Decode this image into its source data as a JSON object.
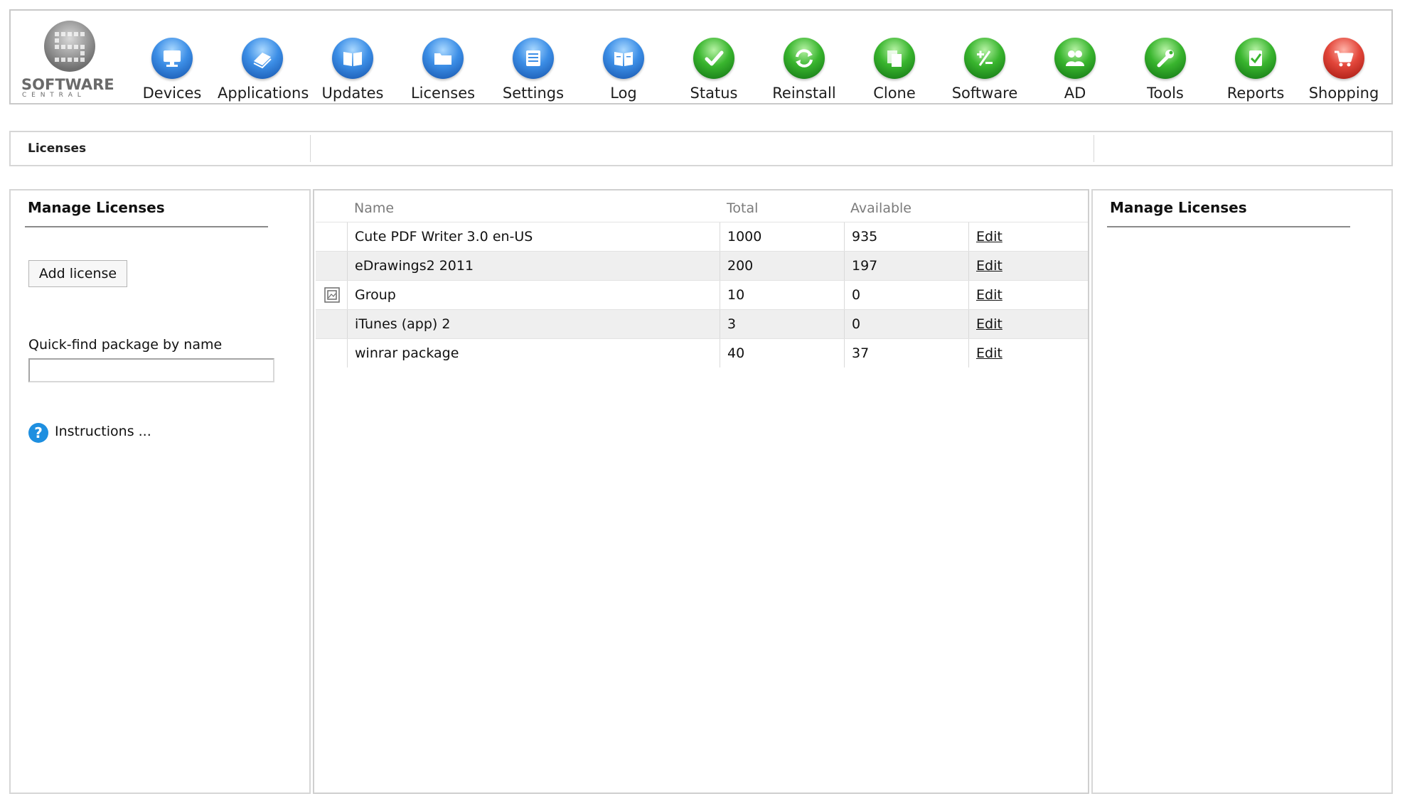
{
  "logo": {
    "text": "SOFTWARE",
    "subtext": "C E N T R A L"
  },
  "nav": [
    {
      "label": "Devices",
      "color": "blue",
      "icon": "monitor-icon"
    },
    {
      "label": "Applications",
      "color": "blue",
      "icon": "applications-icon"
    },
    {
      "label": "Updates",
      "color": "blue",
      "icon": "book-icon"
    },
    {
      "label": "Licenses",
      "color": "blue",
      "icon": "folder-icon"
    },
    {
      "label": "Settings",
      "color": "blue",
      "icon": "settings-icon"
    },
    {
      "label": "Log",
      "color": "blue",
      "icon": "log-book-icon"
    },
    {
      "label": "Status",
      "color": "green",
      "icon": "checkmark-icon"
    },
    {
      "label": "Reinstall",
      "color": "green",
      "icon": "refresh-icon"
    },
    {
      "label": "Clone",
      "color": "green",
      "icon": "copy-icon"
    },
    {
      "label": "Software",
      "color": "green",
      "icon": "plus-minus-icon"
    },
    {
      "label": "AD",
      "color": "green",
      "icon": "users-icon"
    },
    {
      "label": "Tools",
      "color": "green",
      "icon": "wrench-icon"
    },
    {
      "label": "Reports",
      "color": "green",
      "icon": "report-check-icon"
    },
    {
      "label": "Shopping",
      "color": "red",
      "icon": "shopping-cart-icon"
    }
  ],
  "breadcrumb": "Licenses",
  "left_panel": {
    "title": "Manage Licenses",
    "add_button": "Add license",
    "quickfind_label": "Quick-find package by name",
    "quickfind_value": "",
    "instructions": "Instructions ..."
  },
  "table": {
    "headers": {
      "name": "Name",
      "total": "Total",
      "available": "Available"
    },
    "rows": [
      {
        "name": "Cute PDF Writer 3.0 en-US",
        "total": "1000",
        "available": "935",
        "action": "Edit",
        "group": false
      },
      {
        "name": "eDrawings2 2011",
        "total": "200",
        "available": "197",
        "action": "Edit",
        "group": false
      },
      {
        "name": "Group",
        "total": "10",
        "available": "0",
        "action": "Edit",
        "group": true
      },
      {
        "name": "iTunes (app) 2",
        "total": "3",
        "available": "0",
        "action": "Edit",
        "group": false
      },
      {
        "name": "winrar package",
        "total": "40",
        "available": "37",
        "action": "Edit",
        "group": false
      }
    ]
  },
  "right_panel": {
    "title": "Manage Licenses"
  }
}
